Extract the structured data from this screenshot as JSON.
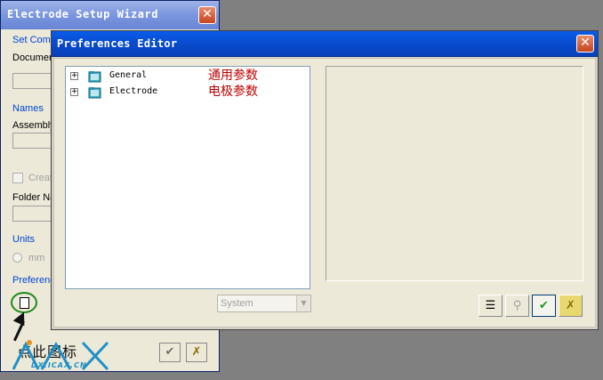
{
  "wizard": {
    "title": "Electrode Setup Wizard",
    "close_glyph": "✕",
    "labels": {
      "set_comp": "Set Comp",
      "document": "Documen",
      "names": "Names",
      "assembly": "Assembly",
      "create": "Creat",
      "folder_name": "Folder Na",
      "units": "Units",
      "mm": "mm",
      "preferences": "Preferenc"
    },
    "caption": "点此图标",
    "ok_glyph": "✔",
    "cancel_glyph": "✗",
    "watermark": "DX.ICAX.CN"
  },
  "dialog": {
    "title": "Preferences Editor",
    "close_glyph": "✕",
    "tree": [
      {
        "expander": "+",
        "label": "General",
        "note": "通用参数"
      },
      {
        "expander": "+",
        "label": "Electrode",
        "note": "电极参数"
      }
    ],
    "select": {
      "value": "System",
      "arrow": "▼"
    },
    "toolbar": {
      "list_glyph": "☰",
      "link_glyph": "⚲",
      "ok_glyph": "✔",
      "cancel_glyph": "✗"
    }
  },
  "colors": {
    "title_blue": "#0a5ce8",
    "note_red": "#c00000",
    "ok_green": "#1e8a1e"
  }
}
